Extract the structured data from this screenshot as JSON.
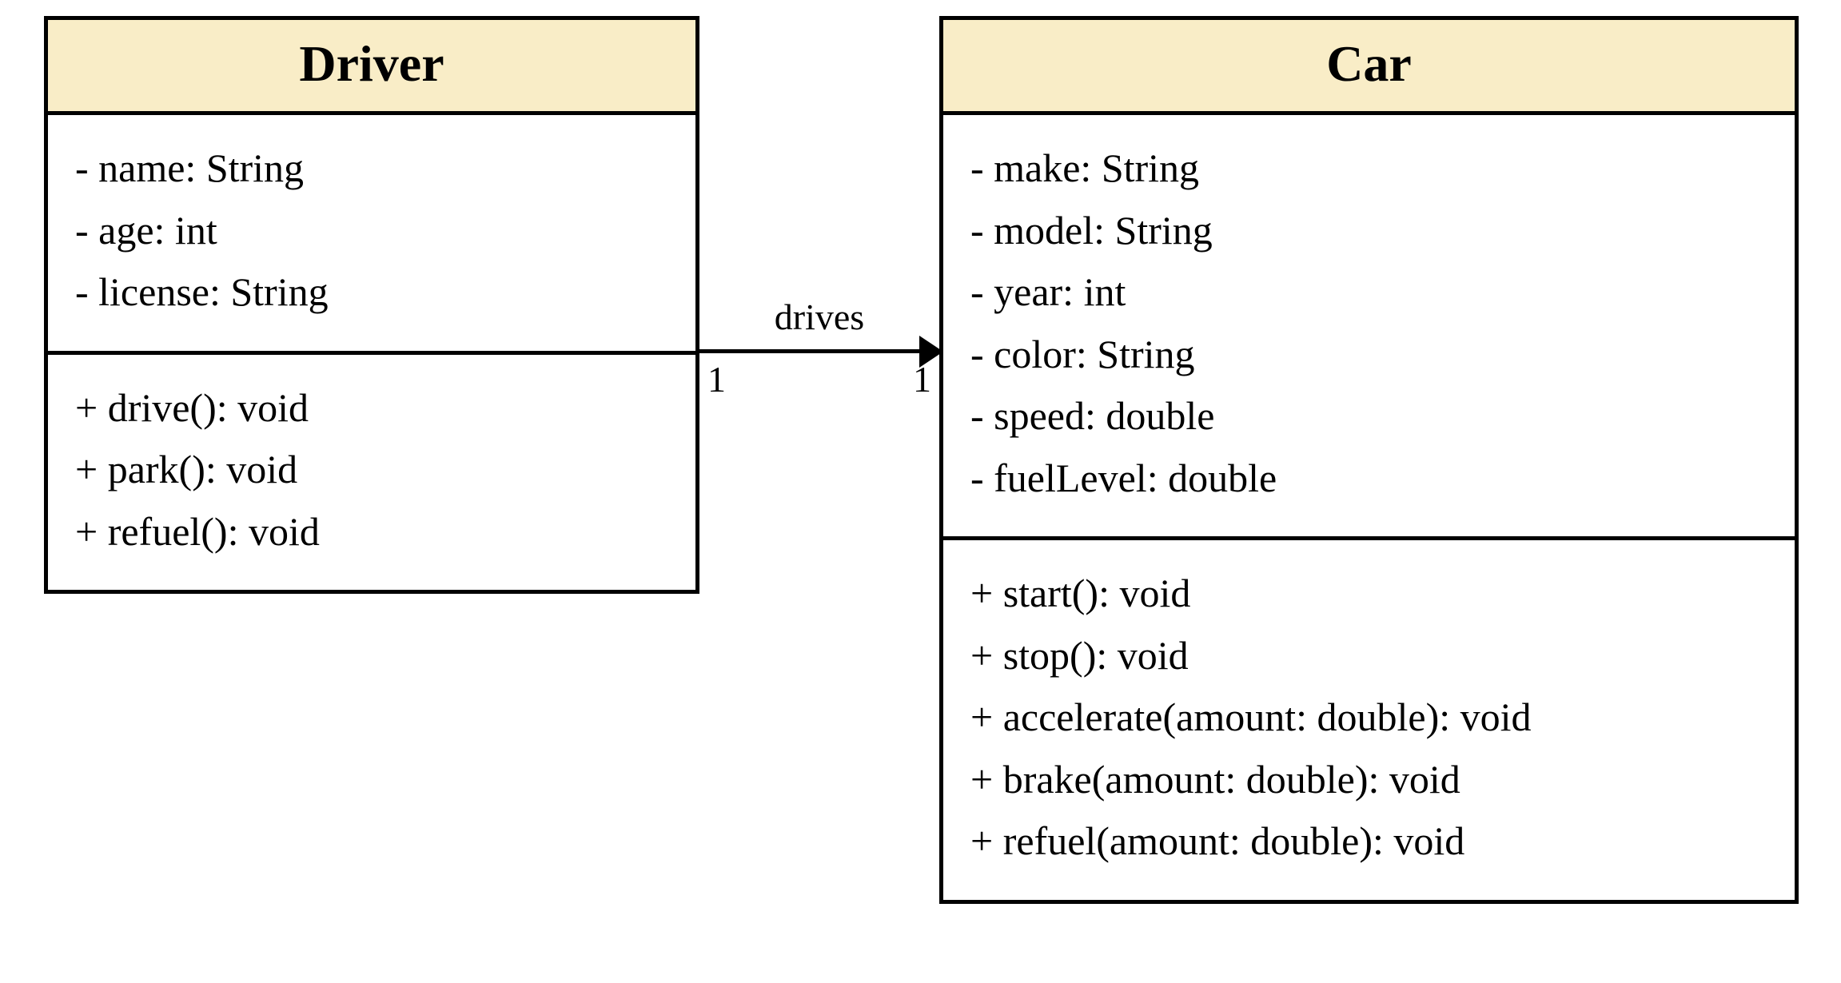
{
  "classes": {
    "driver": {
      "name": "Driver",
      "attributes": [
        "- name: String",
        "- age: int",
        "- license: String"
      ],
      "methods": [
        "+ drive(): void",
        "+ park(): void",
        "+ refuel(): void"
      ]
    },
    "car": {
      "name": "Car",
      "attributes": [
        "- make: String",
        "- model: String",
        "- year: int",
        "- color: String",
        "- speed: double",
        "- fuelLevel: double"
      ],
      "methods": [
        "+ start(): void",
        "+ stop(): void",
        "+ accelerate(amount: double): void",
        "+ brake(amount: double): void",
        "+ refuel(amount: double): void"
      ]
    }
  },
  "association": {
    "label_top": "drives",
    "left_multiplicity": "1",
    "right_multiplicity": "1"
  }
}
